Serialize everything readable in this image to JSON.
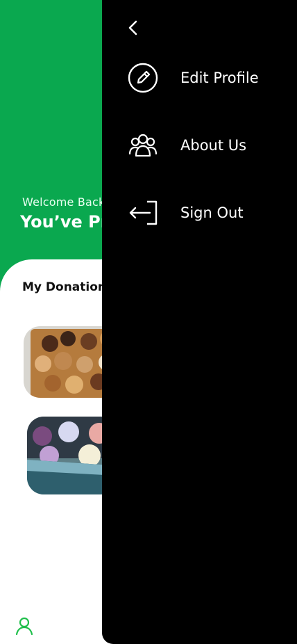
{
  "home": {
    "welcome_text": "Welcome Back",
    "headline_partial": "You’ve Pr",
    "section_title_partial": "My Donation",
    "accent_color": "#0aa84f",
    "cards": [
      {
        "image_name": "cookies-box-photo"
      },
      {
        "image_name": "donut-box-photo"
      }
    ],
    "bottom_nav": {
      "profile_icon": "user-icon"
    }
  },
  "drawer": {
    "back_icon": "chevron-left-icon",
    "items": [
      {
        "label": "Edit Profile",
        "icon": "edit-circle-icon"
      },
      {
        "label": "About Us",
        "icon": "group-users-icon"
      },
      {
        "label": "Sign Out",
        "icon": "sign-out-icon"
      }
    ]
  }
}
